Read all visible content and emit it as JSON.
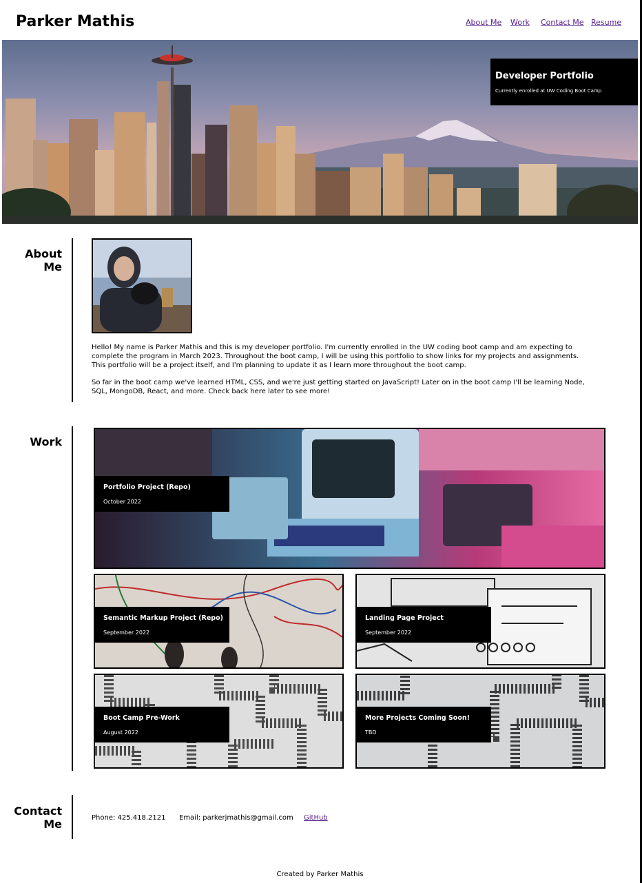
{
  "header": {
    "title": "Parker Mathis",
    "nav": [
      "About Me",
      "Work",
      "Contact Me",
      "Resume"
    ]
  },
  "hero": {
    "image_subject": "Seattle skyline with Space Needle and Mount Rainier",
    "card_title": "Developer Portfolio",
    "card_subtitle": "Currently enrolled at UW Coding Boot Camp"
  },
  "about": {
    "label_line1": "About",
    "label_line2": "Me",
    "photo_subject": "Portrait photo of Parker Mathis holding a dog",
    "paragraphs": [
      "Hello! My name is Parker Mathis and this is my developer portfolio. I'm currently enrolled in the UW coding boot camp and am expecting to complete the program in March 2023. Throughout the boot camp, I will be using this portfolio to show links for my projects and assignments. This portfolio will be a project itself, and I'm planning to update it as I learn more throughout the boot camp.",
      "So far in the boot camp we've learned HTML, CSS, and we're just getting started on JavaScript! Later on in the boot camp I'll be learning Node, SQL, MongoDB, React, and more. Check back here later to see more!"
    ]
  },
  "work": {
    "label": "Work",
    "projects": [
      {
        "title": "Portfolio Project (Repo)",
        "date": "October 2022",
        "image_subject": "Retro computers and Game Boy under pink and blue light"
      },
      {
        "title": "Semantic Markup Project (Repo)",
        "date": "September 2022",
        "image_subject": "Whiteboard covered in colored line diagrams"
      },
      {
        "title": "Landing Page Project",
        "date": "September 2022",
        "image_subject": "Hand-drawn wireframe sketches"
      },
      {
        "title": "Boot Camp Pre-Work",
        "date": "August 2022",
        "image_subject": "Close-up of a circuit-board-like pattern"
      },
      {
        "title": "More Projects Coming Soon!",
        "date": "TBD",
        "image_subject": "Close-up of a circuit-board-like pattern"
      }
    ]
  },
  "contact": {
    "label_line1": "Contact",
    "label_line2": "Me",
    "phone": "Phone: 425.418.2121",
    "email": "Email: parkerjmathis@gmail.com",
    "github": "GitHub"
  },
  "footer": {
    "text": "Created by Parker Mathis"
  },
  "colors": {
    "link": "#551a8b",
    "caption_bg": "#000000",
    "caption_text": "#ffffff"
  }
}
